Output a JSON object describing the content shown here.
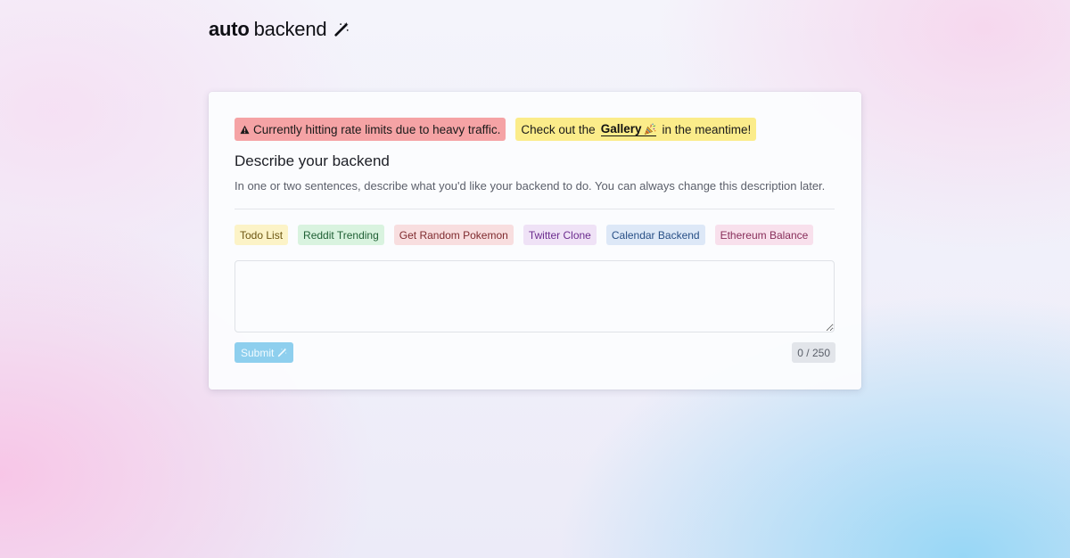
{
  "logo": {
    "bold": "auto",
    "regular": "backend",
    "icon": "magic-wand-icon"
  },
  "alerts": {
    "rate_limit": {
      "icon": "warning-icon",
      "text": "Currently hitting rate limits due to heavy traffic."
    },
    "gallery": {
      "prefix": "Check out the",
      "link_label": "Gallery",
      "icon": "party-popper-icon",
      "suffix": "in the meantime!"
    }
  },
  "form": {
    "title": "Describe your backend",
    "description": "In one or two sentences, describe what you'd like your backend to do. You can always change this description later.",
    "textarea_value": "",
    "submit_label": "Submit",
    "submit_icon": "magic-wand-icon",
    "counter": "0 / 250"
  },
  "suggestions": [
    {
      "label": "Todo List",
      "color": "#fcf3c7"
    },
    {
      "label": "Reddit Trending",
      "color": "#d9f3df"
    },
    {
      "label": "Get Random Pokemon",
      "color": "#f8dedf"
    },
    {
      "label": "Twitter Clone",
      "color": "#efe2f6"
    },
    {
      "label": "Calendar Backend",
      "color": "#dde8f7"
    },
    {
      "label": "Ethereum Balance",
      "color": "#f8e0ec"
    }
  ],
  "colors": {
    "submit": "#8ecfee",
    "alert_danger": "#f5a3a5",
    "alert_warning": "#fbec8a"
  }
}
